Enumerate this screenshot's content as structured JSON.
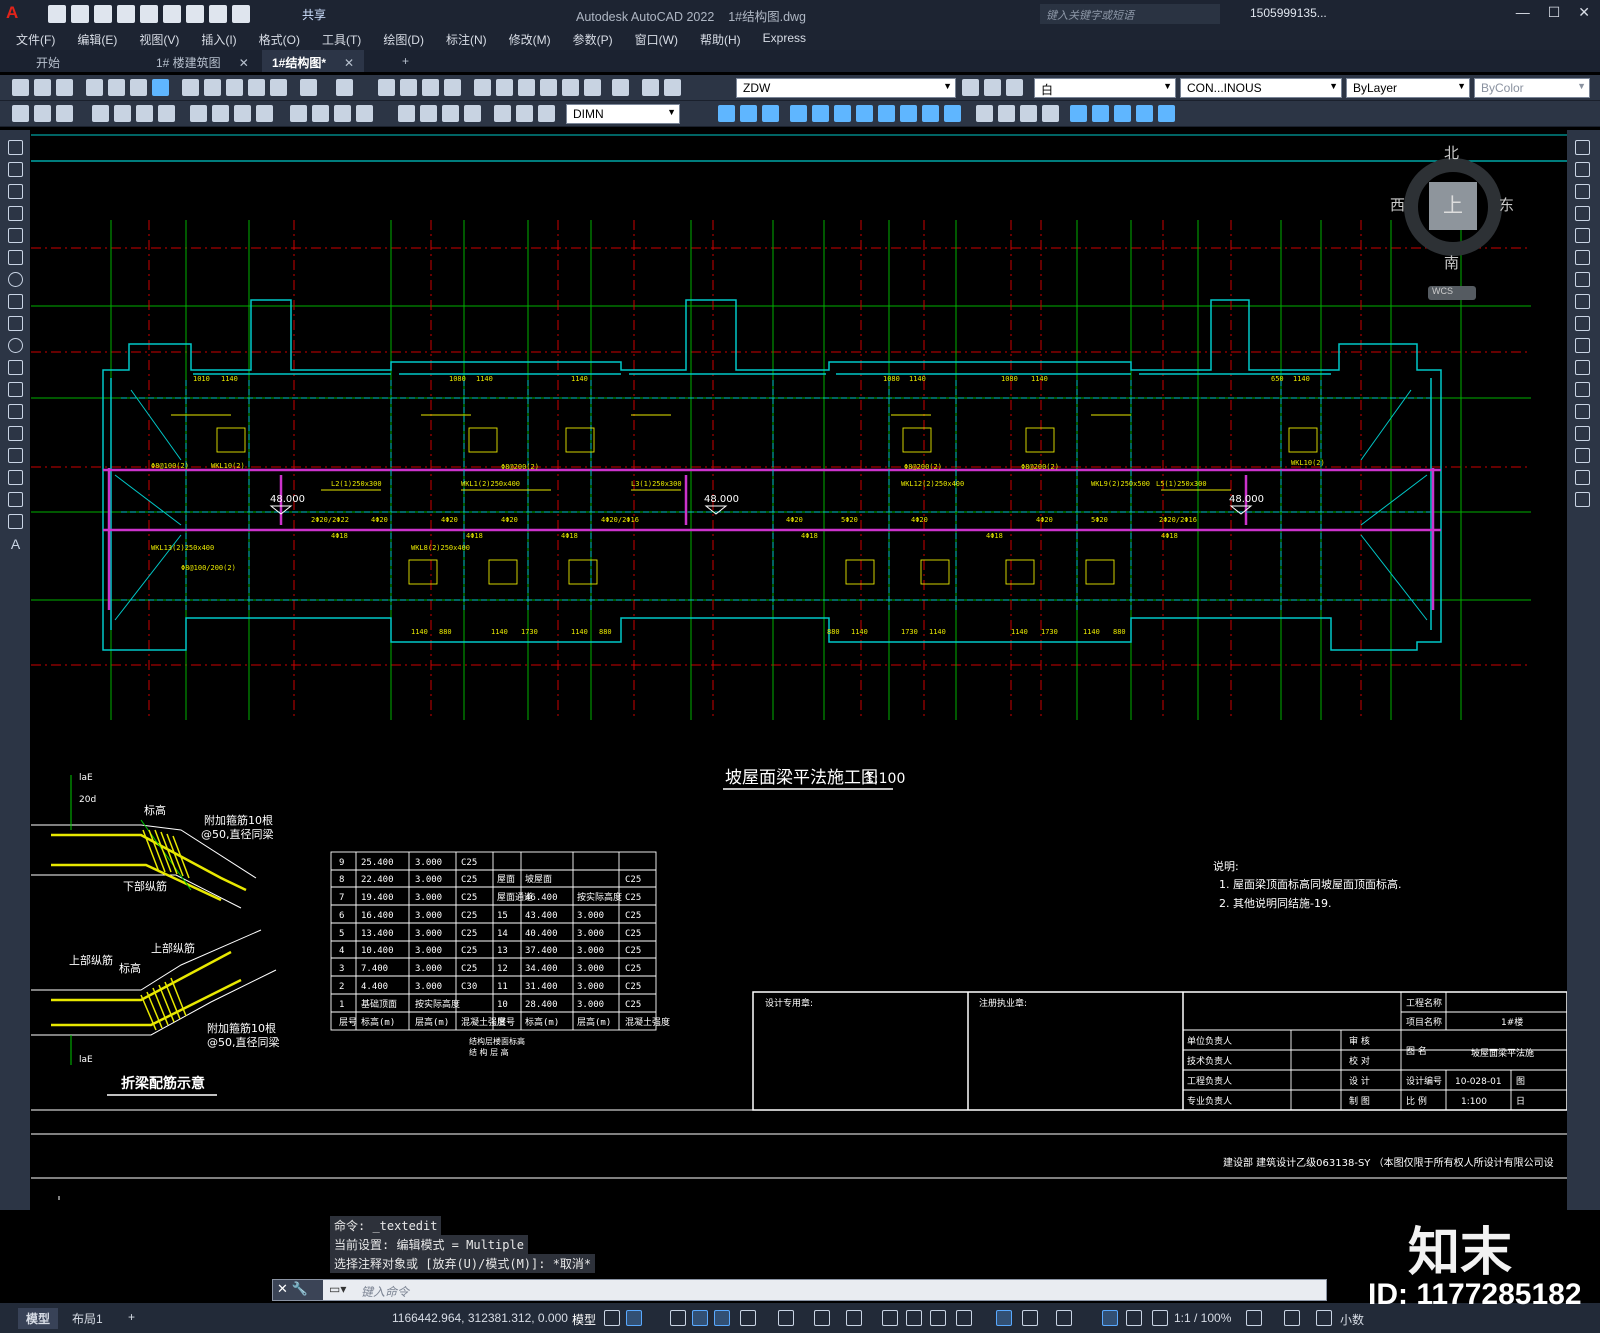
{
  "app": {
    "title": "Autodesk AutoCAD 2022",
    "filename": "1#结构图.dwg",
    "share": "共享",
    "search_placeholder": "键入关键字或短语",
    "user": "1505999135...",
    "logo": "A"
  },
  "menu": [
    "文件(F)",
    "编辑(E)",
    "视图(V)",
    "插入(I)",
    "格式(O)",
    "工具(T)",
    "绘图(D)",
    "标注(N)",
    "修改(M)",
    "参数(P)",
    "窗口(W)",
    "帮助(H)",
    "Express"
  ],
  "file_tabs": [
    {
      "label": "开始"
    },
    {
      "label": "1# 楼建筑图"
    },
    {
      "label": "1#结构图*"
    }
  ],
  "toolbar": {
    "layer": "ZDW",
    "color": "白",
    "linetype": "CON...INOUS",
    "lineweight": "ByLayer",
    "plotstyle": "ByColor",
    "dimstyle": "DIMN"
  },
  "viewcube": {
    "north": "北",
    "south": "南",
    "east": "东",
    "west": "西",
    "top": "上",
    "wcs": "WCS"
  },
  "drawing": {
    "title": "坡屋面梁平法施工图",
    "scale": "1:100",
    "elevation": "48.000",
    "detail_title": "折梁配筋示意",
    "detail_labels": [
      "标高",
      "附加箍筋10根",
      "@50,直径同梁",
      "下部纵筋",
      "上部纵筋",
      "标高",
      "附加箍筋10根",
      "@50,直径同梁",
      "laE",
      "20d"
    ],
    "notes_title": "说明:",
    "notes": [
      "1. 屋面梁顶面标高同坡屋面顶面标高.",
      "2. 其他说明同结施-19."
    ],
    "design_seal": "设计专用章:",
    "reg_seal": "注册执业章:",
    "company": "建设部    建筑设计乙级063138-SY （本图仅限于所有权人所设计有限公司设",
    "floor_table": {
      "caption": "结构层楼面标高",
      "caption2": "结 构 层 高",
      "left_rows": [
        [
          "9",
          "25.400",
          "3.000",
          "C25"
        ],
        [
          "8",
          "22.400",
          "3.000",
          "C25"
        ],
        [
          "7",
          "19.400",
          "3.000",
          "C25"
        ],
        [
          "6",
          "16.400",
          "3.000",
          "C25"
        ],
        [
          "5",
          "13.400",
          "3.000",
          "C25"
        ],
        [
          "4",
          "10.400",
          "3.000",
          "C25"
        ],
        [
          "3",
          "7.400",
          "3.000",
          "C25"
        ],
        [
          "2",
          "4.400",
          "3.000",
          "C30"
        ],
        [
          "1",
          "基础顶面",
          "按实际高度",
          ""
        ],
        [
          "层号",
          "标高(m)",
          "层高(m)",
          "混凝土强度"
        ]
      ],
      "right_rows": [
        [
          "",
          "",
          "",
          "",
          ""
        ],
        [
          "屋面",
          "坡屋面",
          "",
          "",
          "C25"
        ],
        [
          "屋面通道",
          "46.400",
          "按实际高度",
          "",
          "C25"
        ],
        [
          "15",
          "43.400",
          "3.000",
          "",
          "C25"
        ],
        [
          "14",
          "40.400",
          "3.000",
          "",
          "C25"
        ],
        [
          "13",
          "37.400",
          "3.000",
          "",
          "C25"
        ],
        [
          "12",
          "34.400",
          "3.000",
          "",
          "C25"
        ],
        [
          "11",
          "31.400",
          "3.000",
          "",
          "C25"
        ],
        [
          "10",
          "28.400",
          "3.000",
          "",
          "C25"
        ],
        [
          "层号",
          "标高(m)",
          "层高(m)",
          "",
          "混凝土强度"
        ]
      ]
    },
    "title_block": {
      "project_label": "工程名称",
      "item_label": "项目名称",
      "item_value": "1#楼",
      "drawing_label": "图  名",
      "drawing_value": "坡屋面梁平法施",
      "number_label": "设计编号",
      "number_value": "10-028-01",
      "scale_label": "比  例",
      "scale_value": "1:100",
      "sheet_label": "图",
      "date_label": "日",
      "roles": [
        "单位负责人",
        "技术负责人",
        "工程负责人",
        "专业负责人"
      ],
      "checks": [
        "审  核",
        "校  对",
        "设  计",
        "制  图"
      ]
    }
  },
  "command": {
    "history": [
      "命令: _textedit",
      "当前设置: 编辑模式 = Multiple",
      "选择注释对象或 [放弃(U)/模式(M)]: *取消*"
    ],
    "placeholder": "键入命令"
  },
  "status": {
    "tabs": [
      "模型",
      "布局1"
    ],
    "coords": "1166442.964, 312381.312, 0.000",
    "mode": "模型",
    "scale": "1:1 / 100%",
    "units": "小数"
  },
  "watermark": {
    "id": "ID: 1177285182",
    "logo": "知末"
  }
}
